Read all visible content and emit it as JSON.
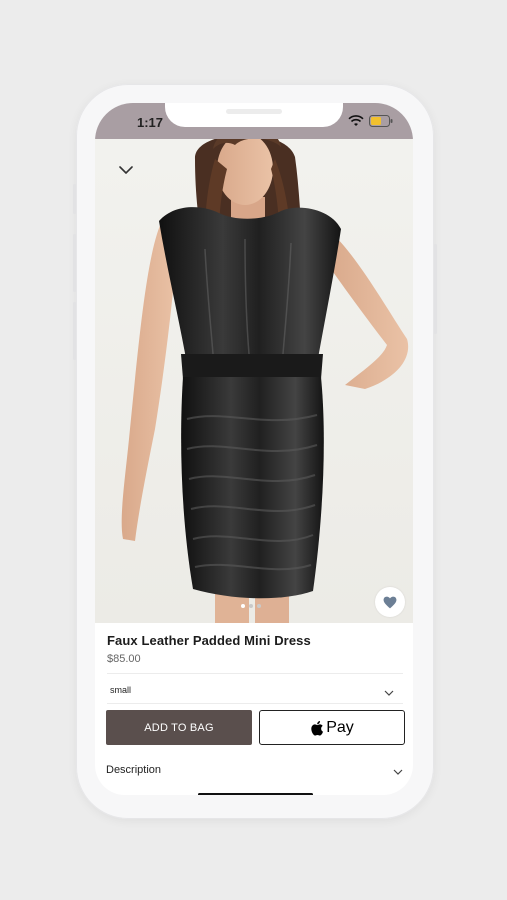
{
  "status_bar": {
    "time": "1:17",
    "background": "#a99ea3"
  },
  "header": {
    "collapse_icon": "chevron-down-icon"
  },
  "product_image": {
    "alt": "Woman wearing black faux leather padded mini dress",
    "favorite_icon": "heart-icon",
    "carousel": {
      "count": 3,
      "active": 0
    }
  },
  "product": {
    "title": "Faux Leather Padded Mini Dress",
    "price": "$85.00"
  },
  "size_select": {
    "value": "small",
    "icon": "chevron-down-icon"
  },
  "actions": {
    "add_to_bag": "ADD TO BAG",
    "apple_pay_label": "Pay",
    "add_to_bag_color": "#5a4f4d"
  },
  "description": {
    "label": "Description",
    "icon": "chevron-down-icon"
  }
}
